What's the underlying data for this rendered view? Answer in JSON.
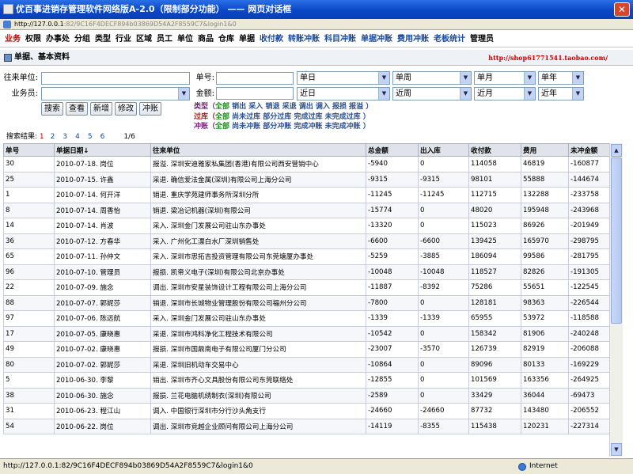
{
  "window": {
    "title": "优百事进销存管理软件网络版A-2.0（限制部分功能）  —— 网页对话框",
    "address_main": "http://127.0.0.1",
    "address_rest": ":82/9C16F4DECF894b03869D54A2F8559C7&login1&0"
  },
  "menu": {
    "items": [
      "业务",
      "权限",
      "办事处",
      "分组",
      "类型",
      "行业",
      "区域",
      "员工",
      "单位",
      "商品",
      "仓库",
      "单据",
      "收付款",
      "转账冲账",
      "科目冲账",
      "单据冲账",
      "费用冲账",
      "老板统计",
      "管理员"
    ]
  },
  "section": {
    "title": "单据、基本资料",
    "link": "http://shop61771541.taobao.com/"
  },
  "filters": {
    "partner_label": "往来单位:",
    "salesman_label": "业务员:",
    "docno_label": "单号:",
    "amount_label": "金额:",
    "partner_value": "",
    "salesman_value": "",
    "docno_value": "",
    "amount_value": "",
    "dropdowns": [
      "单日",
      "单周",
      "单月",
      "单年",
      "近日",
      "近周",
      "近月",
      "近年"
    ],
    "buttons": [
      "搜索",
      "查看",
      "新增",
      "修改",
      "冲账"
    ],
    "type_label": "类型（",
    "type_all": "全部",
    "type_options": "销出 采入 销退 采退 调出 调入 报损 报溢 ）",
    "post_label": "过库（",
    "post_all": "全部",
    "post_options": "尚未过库 部分过库 完成过库 未完成过库 ）",
    "offset_label": "冲账（",
    "offset_all": "全部",
    "offset_options": "尚未冲账 部分冲账 完成冲账 未完成冲账 ）"
  },
  "results": {
    "label": "搜索结果:",
    "current": "1",
    "pages": [
      "2",
      "3",
      "4",
      "5",
      "6"
    ],
    "total": "1/6"
  },
  "table": {
    "columns": [
      "单号",
      "单据日期↓",
      "往来单位",
      "总金额",
      "出入库",
      "收付款",
      "费用",
      "未冲金额"
    ],
    "rows": [
      [
        "30",
        "2010-07-18. 岗位",
        "报溢. 深圳安迪雅家私集团(香港)有限公司西安营销中心",
        "-5940",
        "0",
        "114058",
        "46819",
        "-160877"
      ],
      [
        "25",
        "2010-07-15. 许鑫",
        "采退. 确信爱法金属(深圳)有限公司上海分公司",
        "-9315",
        "-9315",
        "98101",
        "55888",
        "-144674"
      ],
      [
        "1",
        "2010-07-14. 何开洋",
        "销退. 重庆学苑建师事务所深圳分所",
        "-11245",
        "-11245",
        "112715",
        "132288",
        "-233758"
      ],
      [
        "8",
        "2010-07-14. 周香怡",
        "销退. 梁冶记机器(深圳)有限公司",
        "-15774",
        "0",
        "48020",
        "195948",
        "-243968"
      ],
      [
        "14",
        "2010-07-14. 肖波",
        "采入. 深圳金门发展公司驻山东办事处",
        "-13320",
        "0",
        "115023",
        "86926",
        "-201949"
      ],
      [
        "36",
        "2010-07-12. 方春华",
        "采入. 广州化工漂白水厂深圳销售处",
        "-6600",
        "-6600",
        "139425",
        "165970",
        "-298795"
      ],
      [
        "65",
        "2010-07-11. 孙仲文",
        "采入. 深圳市思拓吉投资管理有限公司东莞塘厦办事处",
        "-5259",
        "-3885",
        "186094",
        "99586",
        "-281795"
      ],
      [
        "96",
        "2010-07-10. 管理员",
        "报损. 凯帝义电子(深圳)有限公司北京办事处",
        "-10048",
        "-10048",
        "118527",
        "82826",
        "-191305"
      ],
      [
        "22",
        "2010-07-09. 施念",
        "调出. 深圳市安星装饰设计工程有限公司上海分公司",
        "-11887",
        "-8392",
        "75286",
        "55651",
        "-122545"
      ],
      [
        "88",
        "2010-07-07. 郭妮莎",
        "销退. 深圳市长城物业管理股份有限公司福州分公司",
        "-7800",
        "0",
        "128181",
        "98363",
        "-226544"
      ],
      [
        "97",
        "2010-07-06. 陈远航",
        "采入. 深圳金门发展公司驻山东办事处",
        "-1339",
        "-1339",
        "65955",
        "53972",
        "-118588"
      ],
      [
        "17",
        "2010-07-05. 康晓惠",
        "采退. 深圳市鸿科净化工程技术有限公司",
        "-10542",
        "0",
        "158342",
        "81906",
        "-240248"
      ],
      [
        "49",
        "2010-07-02. 康晓惠",
        "报损. 深圳市国鼎南电子有限公司厦门分公司",
        "-23007",
        "-3570",
        "126739",
        "82919",
        "-206088"
      ],
      [
        "80",
        "2010-07-02. 郭妮莎",
        "采退. 深圳旧机动车交易中心",
        "-10864",
        "0",
        "89096",
        "80133",
        "-169229"
      ],
      [
        "5",
        "2010-06-30. 李黎",
        "销出. 深圳市齐心文具股份有限公司东莞联络处",
        "-12855",
        "0",
        "101569",
        "163356",
        "-264925"
      ],
      [
        "38",
        "2010-06-30. 施念",
        "报损. 兰花电脑机绣制衣(深圳)有限公司",
        "-2589",
        "0",
        "33429",
        "36044",
        "-69473"
      ],
      [
        "31",
        "2010-06-23. 程江山",
        "调入. 中国银行深圳市分行沙头角支行",
        "-24660",
        "-24660",
        "87732",
        "143480",
        "-206552"
      ],
      [
        "54",
        "2010-06-22. 岗位",
        "调出. 深圳市竞越企业顾问有限公司上海分公司",
        "-14119",
        "-8355",
        "115438",
        "120231",
        "-227314"
      ]
    ]
  },
  "status": {
    "url": "http://127.0.0.1:82/9C16F4DECF894b03869D54A2F8559C7&login1&0",
    "zone": "Internet"
  }
}
